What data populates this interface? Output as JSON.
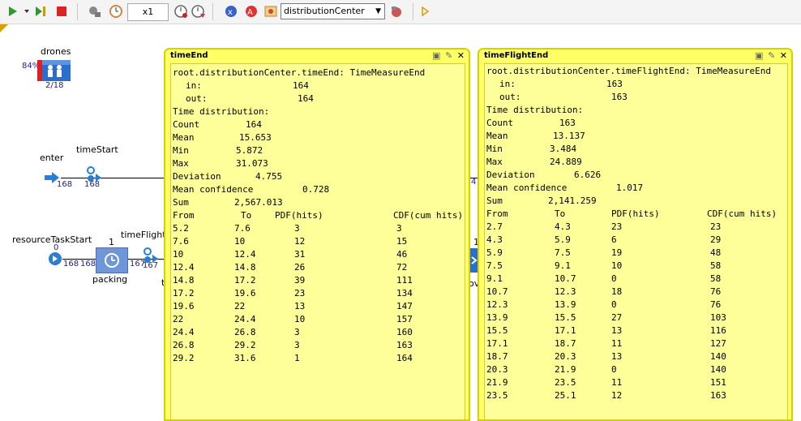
{
  "toolbar": {
    "speed": "x1",
    "agent": "distributionCenter",
    "icons": [
      "run-icon",
      "run-dropdown-icon",
      "step-icon",
      "stop-icon",
      "connections-icon",
      "clock-icon",
      "zoom-out-icon",
      "slow-down-icon",
      "speed-up-icon",
      "navigate-icon",
      "view-icon",
      "agent-icon",
      "camera-icon",
      "log-icon"
    ]
  },
  "canvas": {
    "drones": {
      "name": "drones",
      "pct": "84%",
      "count": "2/18"
    },
    "enter": {
      "name": "enter",
      "count": "168"
    },
    "timeStart": {
      "name": "timeStart",
      "count": "168"
    },
    "resourceTaskStart": {
      "name": "resourceTaskStart",
      "top": "0",
      "left": "168",
      "right": "168"
    },
    "packing": {
      "name": "packing",
      "top": "1"
    },
    "timeFlightStart": {
      "name": "timeFlightSt",
      "count": "167",
      "count2": "167"
    },
    "edge_fragment": "4",
    "right_fragment_top": "1",
    "right_fragment_bottom": "ov",
    "letter_t": "t"
  },
  "popups": [
    {
      "title": "timeEnd",
      "header": "root.distributionCenter.timeEnd: TimeMeasureEnd",
      "in_label": "in:",
      "in_val": "164",
      "out_label": "out:",
      "out_val": "164",
      "dist_label": "Time distribution:",
      "stats": [
        {
          "k": "Count",
          "v": "164"
        },
        {
          "k": "Mean",
          "v": "15.653"
        },
        {
          "k": "Min",
          "v": "5.872"
        },
        {
          "k": "Max",
          "v": "31.073"
        },
        {
          "k": "Deviation",
          "v": "4.755"
        },
        {
          "k": "Mean confidence",
          "v": "0.728"
        },
        {
          "k": "Sum",
          "v": "2,567.013"
        }
      ],
      "cols": [
        "From",
        "To",
        "PDF(hits)",
        "CDF(cum hits)"
      ],
      "rows": [
        [
          "5.2",
          "7.6",
          "3",
          "3"
        ],
        [
          "7.6",
          "10",
          "12",
          "15"
        ],
        [
          "10",
          "12.4",
          "31",
          "46"
        ],
        [
          "12.4",
          "14.8",
          "26",
          "72"
        ],
        [
          "14.8",
          "17.2",
          "39",
          "111"
        ],
        [
          "17.2",
          "19.6",
          "23",
          "134"
        ],
        [
          "19.6",
          "22",
          "13",
          "147"
        ],
        [
          "22",
          "24.4",
          "10",
          "157"
        ],
        [
          "24.4",
          "26.8",
          "3",
          "160"
        ],
        [
          "26.8",
          "29.2",
          "3",
          "163"
        ],
        [
          "29.2",
          "31.6",
          "1",
          "164"
        ]
      ]
    },
    {
      "title": "timeFlightEnd",
      "header": "root.distributionCenter.timeFlightEnd: TimeMeasureEnd",
      "in_label": "in:",
      "in_val": "163",
      "out_label": "out:",
      "out_val": "163",
      "dist_label": "Time distribution:",
      "stats": [
        {
          "k": "Count",
          "v": "163"
        },
        {
          "k": "Mean",
          "v": "13.137"
        },
        {
          "k": "Min",
          "v": "3.484"
        },
        {
          "k": "Max",
          "v": "24.889"
        },
        {
          "k": "Deviation",
          "v": "6.626"
        },
        {
          "k": "Mean confidence",
          "v": "1.017"
        },
        {
          "k": "Sum",
          "v": "2,141.259"
        }
      ],
      "cols": [
        "From",
        "To",
        "PDF(hits)",
        "CDF(cum hits)"
      ],
      "rows": [
        [
          "2.7",
          "4.3",
          "23",
          "23"
        ],
        [
          "4.3",
          "5.9",
          "6",
          "29"
        ],
        [
          "5.9",
          "7.5",
          "19",
          "48"
        ],
        [
          "7.5",
          "9.1",
          "10",
          "58"
        ],
        [
          "9.1",
          "10.7",
          "0",
          "58"
        ],
        [
          "10.7",
          "12.3",
          "18",
          "76"
        ],
        [
          "12.3",
          "13.9",
          "0",
          "76"
        ],
        [
          "13.9",
          "15.5",
          "27",
          "103"
        ],
        [
          "15.5",
          "17.1",
          "13",
          "116"
        ],
        [
          "17.1",
          "18.7",
          "11",
          "127"
        ],
        [
          "18.7",
          "20.3",
          "13",
          "140"
        ],
        [
          "20.3",
          "21.9",
          "0",
          "140"
        ],
        [
          "21.9",
          "23.5",
          "11",
          "151"
        ],
        [
          "23.5",
          "25.1",
          "12",
          "163"
        ]
      ]
    }
  ]
}
